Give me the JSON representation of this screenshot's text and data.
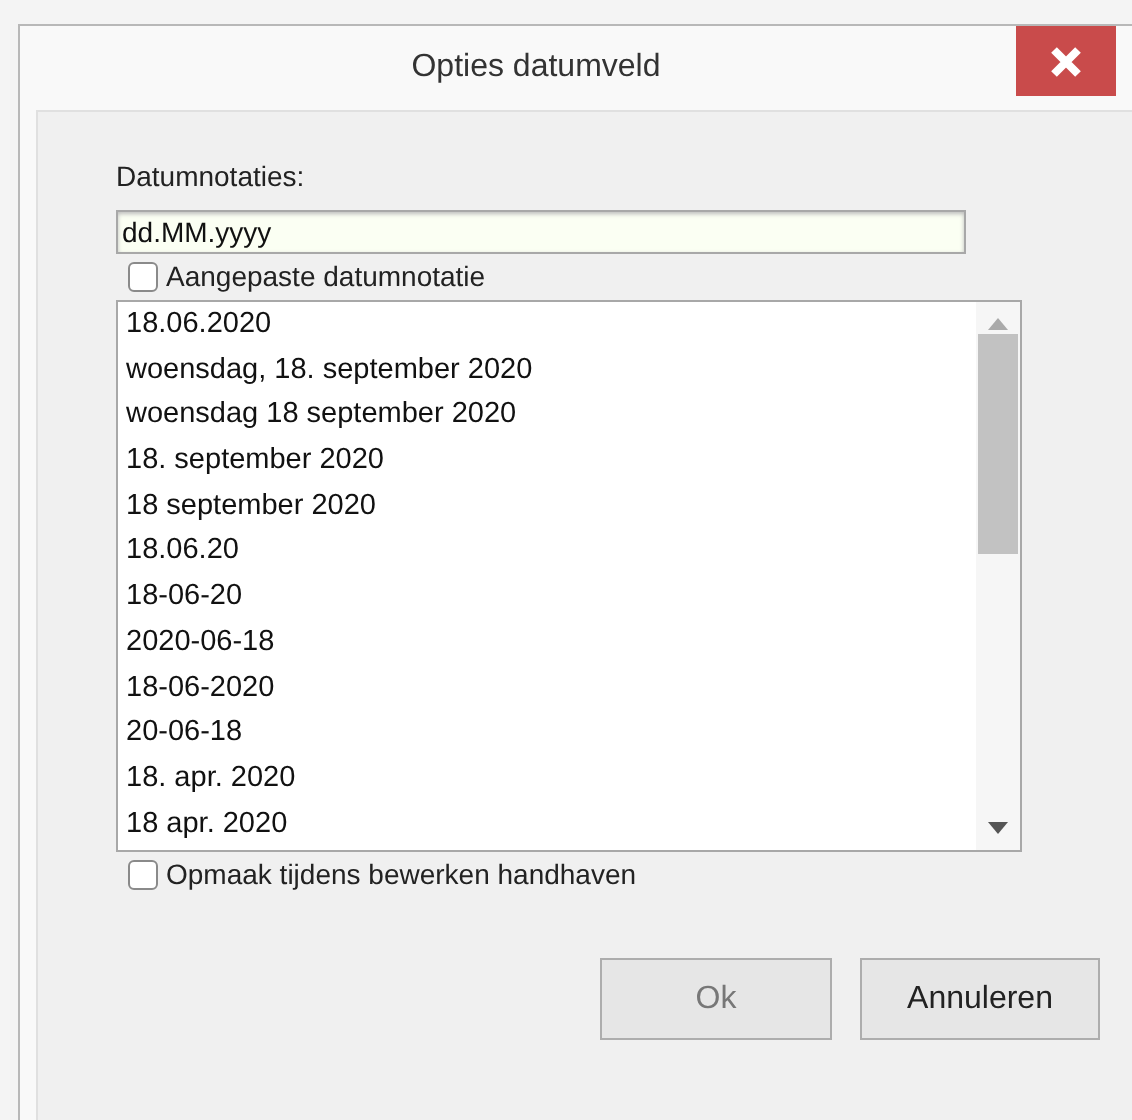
{
  "window": {
    "title": "Opties datumveld"
  },
  "format_label": "Datumnotaties:",
  "format_field": {
    "value": "dd.MM.yyyy"
  },
  "custom_format": {
    "label": "Aangepaste datumnotatie",
    "checked": false
  },
  "formats": [
    {
      "text": "18.06.2020",
      "selected": false
    },
    {
      "text": "woensdag, 18. september 2020",
      "selected": false
    },
    {
      "text": "woensdag 18 september 2020",
      "selected": false
    },
    {
      "text": "18. september 2020",
      "selected": false
    },
    {
      "text": "18 september 2020",
      "selected": false
    },
    {
      "text": "18.06.20",
      "selected": false
    },
    {
      "text": "18-06-20",
      "selected": false
    },
    {
      "text": "2020-06-18",
      "selected": false
    },
    {
      "text": "18-06-2020",
      "selected": false
    },
    {
      "text": "20-06-18",
      "selected": false
    },
    {
      "text": "18. apr. 2020",
      "selected": false
    },
    {
      "text": "18 apr. 2020",
      "selected": false
    }
  ],
  "keep_format": {
    "label": "Opmaak tijdens bewerken handhaven",
    "checked": false
  },
  "buttons": [
    {
      "label": "Ok",
      "disabled": true
    },
    {
      "label": "Annuleren",
      "disabled": false
    }
  ]
}
